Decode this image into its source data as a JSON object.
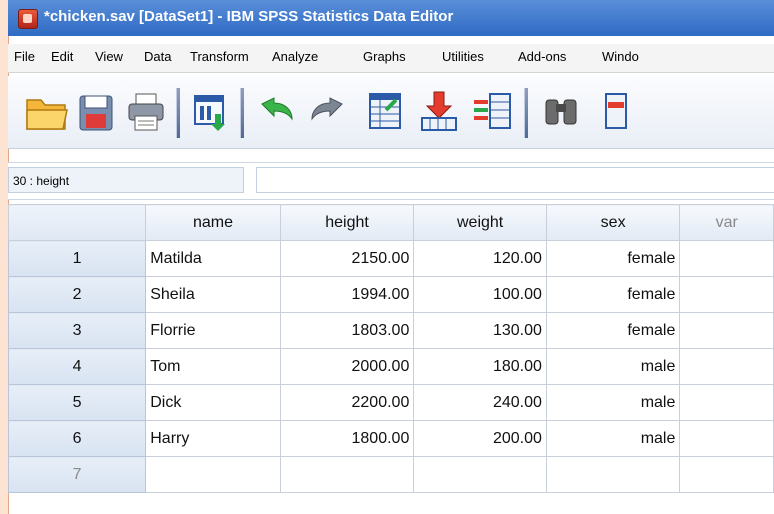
{
  "window": {
    "title": "*chicken.sav [DataSet1] - IBM SPSS Statistics Data Editor"
  },
  "menu": [
    "File",
    "Edit",
    "View",
    "Data",
    "Transform",
    "Analyze",
    "Graphs",
    "Utilities",
    "Add-ons",
    "Windo"
  ],
  "toolbar": {
    "buttons": [
      "open-folder-icon",
      "save-disk-icon",
      "print-icon",
      "recall-dialog-icon",
      "undo-icon",
      "redo-icon",
      "goto-case-icon",
      "goto-variable-icon",
      "variables-icon",
      "find-binoculars-icon",
      "insert-cases-icon"
    ]
  },
  "cell_editor": {
    "reference": "30 : height",
    "value": ""
  },
  "grid": {
    "columns": [
      "name",
      "height",
      "weight",
      "sex",
      "var"
    ],
    "rows": [
      {
        "num": "1",
        "name": "Matilda",
        "height": "2150.00",
        "weight": "120.00",
        "sex": "female"
      },
      {
        "num": "2",
        "name": "Sheila",
        "height": "1994.00",
        "weight": "100.00",
        "sex": "female"
      },
      {
        "num": "3",
        "name": "Florrie",
        "height": "1803.00",
        "weight": "130.00",
        "sex": "female"
      },
      {
        "num": "4",
        "name": "Tom",
        "height": "2000.00",
        "weight": "180.00",
        "sex": "male"
      },
      {
        "num": "5",
        "name": "Dick",
        "height": "2200.00",
        "weight": "240.00",
        "sex": "male"
      },
      {
        "num": "6",
        "name": "Harry",
        "height": "1800.00",
        "weight": "200.00",
        "sex": "male"
      },
      {
        "num": "7",
        "name": "",
        "height": "",
        "weight": "",
        "sex": ""
      }
    ]
  }
}
